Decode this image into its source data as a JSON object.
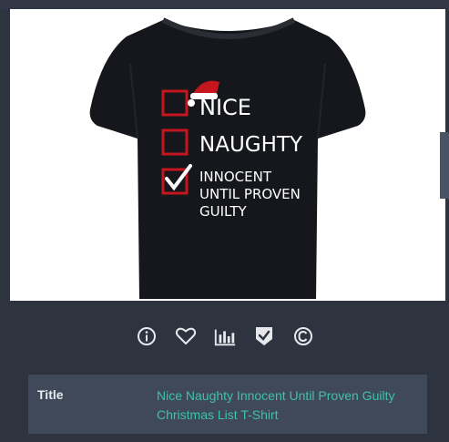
{
  "product": {
    "image_alt": "Black t-shirt with Nice / Naughty / Innocent until proven guilty checklist",
    "print": {
      "line1": "NICE",
      "line2": "NAUGHTY",
      "line3a": "INNOCENT",
      "line3b": "UNTIL PROVEN",
      "line3c": "GUILTY"
    }
  },
  "actions": {
    "icons": [
      "info-icon",
      "heart-icon",
      "bar-chart-icon",
      "shield-check-icon",
      "copyright-icon"
    ]
  },
  "details": {
    "title_label": "Title",
    "title_value": "Nice Naughty Innocent Until Proven Guilty Christmas List T-Shirt"
  },
  "colors": {
    "background": "#2d3440",
    "panel": "#3f4959",
    "accent": "#3fc1aa",
    "shirt": "#15171c",
    "checkbox": "#c4161c"
  }
}
